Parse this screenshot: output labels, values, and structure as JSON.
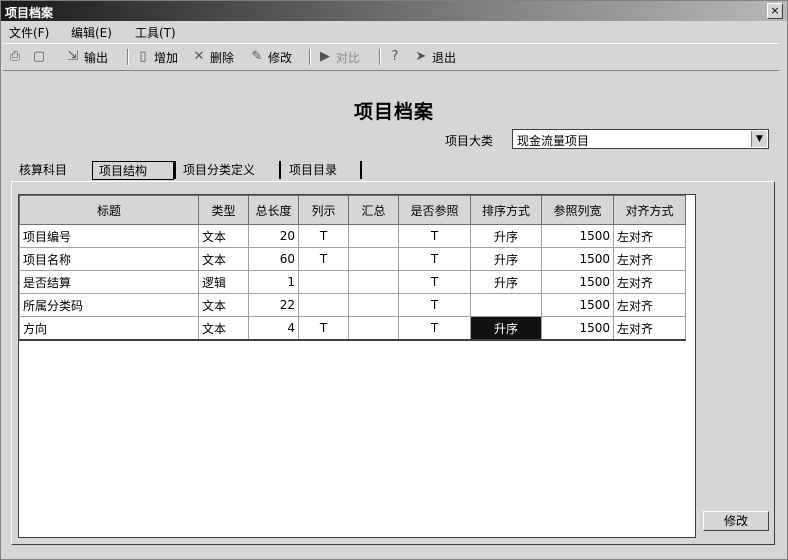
{
  "window": {
    "title": "项目档案",
    "close_glyph": "×"
  },
  "menu": [
    {
      "label": "文件(F)"
    },
    {
      "label": "编辑(E)"
    },
    {
      "label": "工具(T)"
    }
  ],
  "toolbar": {
    "print_icon": "print-icon",
    "preview_icon": "print-preview-icon",
    "export_label": "输出",
    "add_label": "增加",
    "delete_label": "删除",
    "modify_label": "修改",
    "contrast_label": "对比",
    "exit_label": "退出"
  },
  "form": {
    "heading": "项目档案",
    "category_label": "项目大类",
    "category_value": "现金流量项目"
  },
  "tabs": [
    {
      "label": "核算科目",
      "active": false
    },
    {
      "label": "项目结构",
      "active": true
    },
    {
      "label": "项目分类定义",
      "active": false
    },
    {
      "label": "项目目录",
      "active": false
    }
  ],
  "table": {
    "columns": [
      "标题",
      "类型",
      "总长度",
      "列示",
      "汇总",
      "是否参照",
      "排序方式",
      "参照列宽",
      "对齐方式"
    ],
    "rows": [
      [
        "项目编号",
        "文本",
        "20",
        "T",
        "",
        "T",
        "升序",
        "1500",
        "左对齐"
      ],
      [
        "项目名称",
        "文本",
        "60",
        "T",
        "",
        "T",
        "升序",
        "1500",
        "左对齐"
      ],
      [
        "是否结算",
        "逻辑",
        "1",
        "",
        "",
        "T",
        "升序",
        "1500",
        "左对齐"
      ],
      [
        "所属分类码",
        "文本",
        "22",
        "",
        "",
        "T",
        "",
        "1500",
        "左对齐"
      ],
      [
        "方向",
        "文本",
        "4",
        "T",
        "",
        "T",
        "升序",
        "1500",
        "左对齐"
      ]
    ],
    "selected_cell": {
      "row": 4,
      "col": 6
    }
  },
  "edit_button_label": "修改"
}
